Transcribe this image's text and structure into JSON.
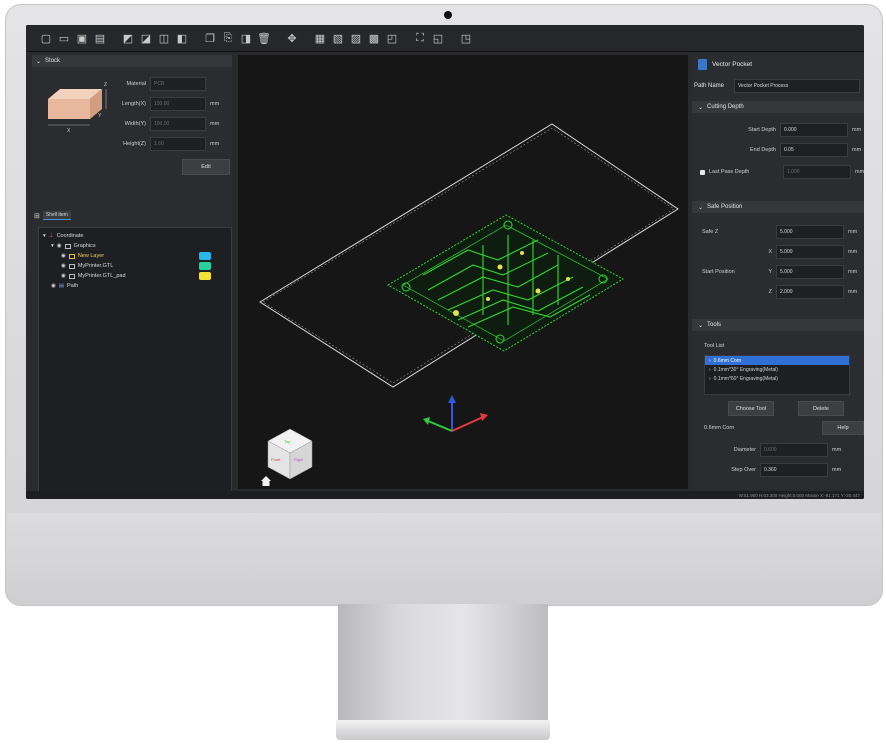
{
  "toolbar": {
    "icons": [
      "new-file-icon",
      "open-folder-icon",
      "save-icon",
      "save-as-icon",
      "import-icon",
      "import-image-icon",
      "import-vector-icon",
      "import-model-icon",
      "copy-icon",
      "paste-icon",
      "mirror-icon",
      "delete-icon",
      "transform-icon",
      "align-icon",
      "group-icon",
      "ungroup-icon",
      "boolean-icon",
      "offset-icon",
      "fit-view-icon",
      "preview-icon",
      "export-icon"
    ]
  },
  "stock": {
    "header": "Stock",
    "material_label": "Material",
    "material_value": "PCB",
    "length_label": "Length(X)",
    "length_value": "100.00",
    "width_label": "Width(Y)",
    "width_value": "100.00",
    "height_label": "Height(Z)",
    "height_value": "1.60",
    "unit": "mm",
    "edit_label": "Edit",
    "axis_x": "X",
    "axis_y": "Y",
    "axis_z": "Z"
  },
  "tree": {
    "tab_label": "Shell item",
    "items": [
      {
        "label": "Coordinate"
      },
      {
        "label": "Graphics"
      },
      {
        "label": "New Layer"
      },
      {
        "label": "MyPrinter.GTL"
      },
      {
        "label": "MyPrinter.GTL_pad"
      },
      {
        "label": "Path"
      }
    ],
    "swatch_colors": [
      "#29b6e8",
      "#27d39a",
      "#f2e233"
    ]
  },
  "viewport": {
    "cube_front": "Front",
    "cube_top": "Top",
    "cube_right": "Right"
  },
  "right": {
    "app_title": "Vector Pocket",
    "path_name_label": "Path Name",
    "path_name_value": "Vector Pocket Process",
    "cutting_depth_header": "Cutting Depth",
    "start_depth_label": "Start Depth",
    "start_depth_value": "0.000",
    "end_depth_label": "End Depth",
    "end_depth_value": "0.05",
    "last_pass_label": "Last Pass Depth",
    "last_pass_value": "1.000",
    "safe_position_header": "Safe Position",
    "safe_z_label": "Safe Z",
    "safe_z_value": "5.000",
    "start_position_label": "Start Position",
    "x_label": "X",
    "x_value": "5.000",
    "y_label": "Y",
    "y_value": "5.000",
    "z_label": "Z",
    "z_value": "2.000",
    "tools_header": "Tools",
    "tool_list_label": "Tool List",
    "tools": [
      "0.6mm Corn",
      "0.1mm*30° Engraving(Metal)",
      "0.1mm*60° Engraving(Metal)"
    ],
    "choose_tool_label": "Choose Tool",
    "delete_label": "Delete",
    "selected_tool": "0.6mm Corn",
    "help_label": "Help",
    "diameter_label": "Diameter",
    "diameter_value": "0.600",
    "step_over_label": "Step Over",
    "step_over_value": "0.360",
    "unit": "mm"
  },
  "statusbar": {
    "text": "W:51.900 H:63.300 Height:0.000     Mouse X:-61.171 Y:-20.447"
  },
  "colors": {
    "pcb_trace": "#2fd82f",
    "pcb_pad": "#e8e14a",
    "selection": "#2f6fd6",
    "axis_x": "#e23b3b",
    "axis_y": "#2ecc40",
    "axis_z": "#2f5be0"
  }
}
